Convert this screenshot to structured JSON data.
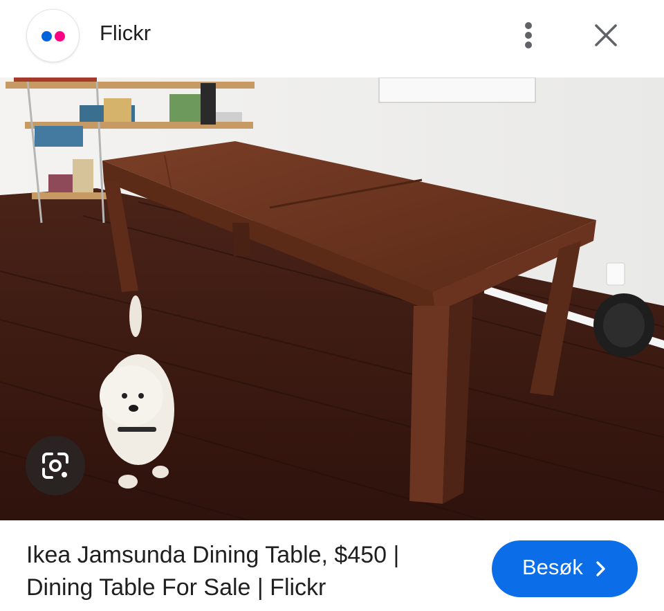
{
  "header": {
    "site_name": "Flickr",
    "logo_colors": {
      "blue": "#0063dc",
      "pink": "#ff0084"
    }
  },
  "image": {
    "alt": "Ikea Jamsunda Dining Table, $450 | Dining Table For Sale | Flickr"
  },
  "result": {
    "title": "Ikea Jamsunda Dining Table, $450 | Dining Table For Sale | Flickr",
    "visit_label": "Besøk",
    "accent": "#0b6ee8"
  },
  "icons": {
    "more": "more-vert-icon",
    "close": "close-icon",
    "lens": "google-lens-icon",
    "visit_chevron": "chevron-right-icon"
  }
}
